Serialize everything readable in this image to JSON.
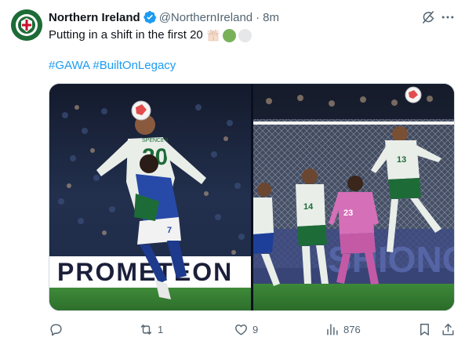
{
  "author": {
    "name": "Northern Ireland",
    "handle": "@NorthernIreland",
    "separator": "·",
    "time": "8m"
  },
  "tweet": {
    "text": "Putting in a shift in the first 20",
    "hashtags": "#GAWA #BuiltOnLegacy"
  },
  "media": {
    "photo_left": {
      "ad_board": "PROMETEON",
      "shirt_number": "20",
      "shirt_name": "SPENCER",
      "opponent_number": "7"
    },
    "photo_right": {
      "shirt_numbers": [
        "13",
        "14",
        "23"
      ],
      "ad_board": "SHIONO"
    }
  },
  "actions": {
    "reply_count": "",
    "repost_count": "1",
    "like_count": "9",
    "views_count": "876"
  },
  "icons": {
    "verified": "verified-badge-icon",
    "grok": "grok-icon",
    "more": "more-icon",
    "reply": "reply-icon",
    "repost": "repost-icon",
    "like": "heart-icon",
    "views": "views-icon",
    "bookmark": "bookmark-icon",
    "share": "share-icon"
  },
  "colors": {
    "link": "#1d9bf0",
    "verified": "#1d9bf0",
    "secondary_text": "#536471",
    "green_circle": "#78b159",
    "white_circle": "#e6e7e8"
  }
}
